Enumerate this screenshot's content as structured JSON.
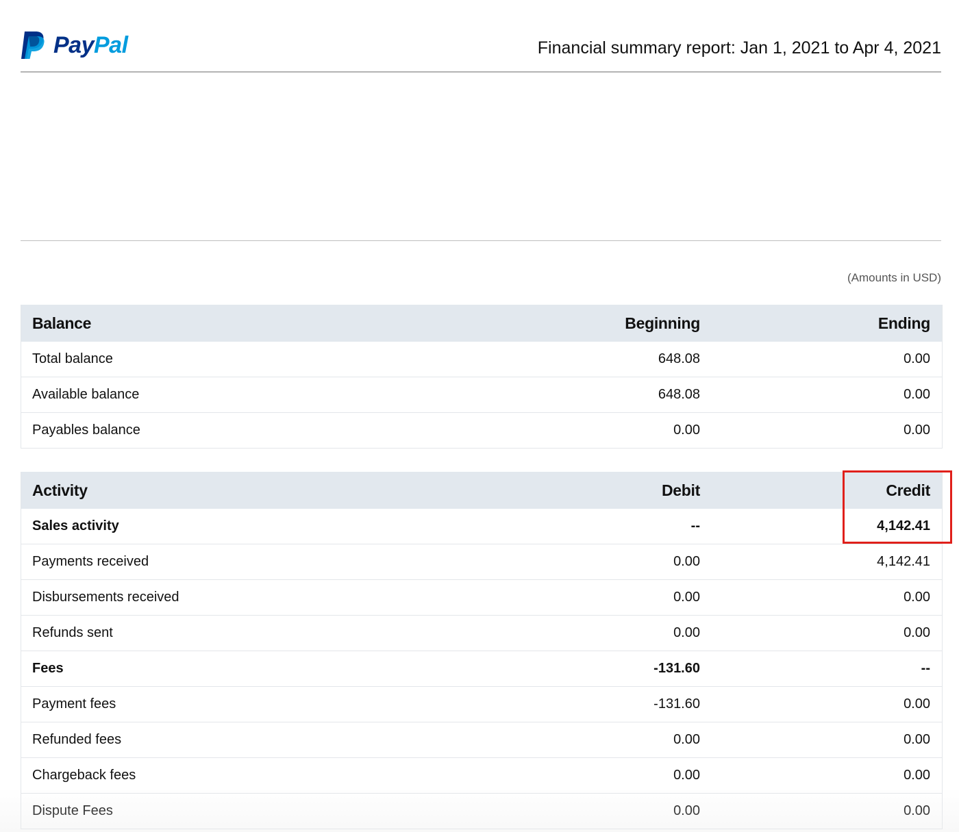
{
  "header": {
    "logo_text_pay": "Pay",
    "logo_text_pal": "Pal",
    "report_title": "Financial summary report: Jan 1, 2021 to Apr 4, 2021"
  },
  "amounts_note": "(Amounts in USD)",
  "balance": {
    "headers": [
      "Balance",
      "Beginning",
      "Ending"
    ],
    "rows": [
      {
        "label": "Total balance",
        "beginning": "648.08",
        "ending": "0.00"
      },
      {
        "label": "Available balance",
        "beginning": "648.08",
        "ending": "0.00"
      },
      {
        "label": "Payables balance",
        "beginning": "0.00",
        "ending": "0.00"
      }
    ]
  },
  "activity": {
    "headers": [
      "Activity",
      "Debit",
      "Credit"
    ],
    "rows": [
      {
        "label": "Sales activity",
        "debit": "--",
        "credit": "4,142.41",
        "bold": true
      },
      {
        "label": "Payments received",
        "debit": "0.00",
        "credit": "4,142.41",
        "bold": false
      },
      {
        "label": "Disbursements received",
        "debit": "0.00",
        "credit": "0.00",
        "bold": false
      },
      {
        "label": "Refunds sent",
        "debit": "0.00",
        "credit": "0.00",
        "bold": false
      },
      {
        "label": "Fees",
        "debit": "-131.60",
        "credit": "--",
        "bold": true
      },
      {
        "label": "Payment fees",
        "debit": "-131.60",
        "credit": "0.00",
        "bold": false
      },
      {
        "label": "Refunded fees",
        "debit": "0.00",
        "credit": "0.00",
        "bold": false
      },
      {
        "label": "Chargeback fees",
        "debit": "0.00",
        "credit": "0.00",
        "bold": false
      },
      {
        "label": "Dispute Fees",
        "debit": "0.00",
        "credit": "0.00",
        "bold": false
      }
    ]
  },
  "colors": {
    "brand_dark": "#003087",
    "brand_light": "#009cde",
    "header_row_bg": "#e2e8ee",
    "highlight": "#e0201b"
  },
  "icons": {
    "logo": "paypal-logo-icon"
  }
}
